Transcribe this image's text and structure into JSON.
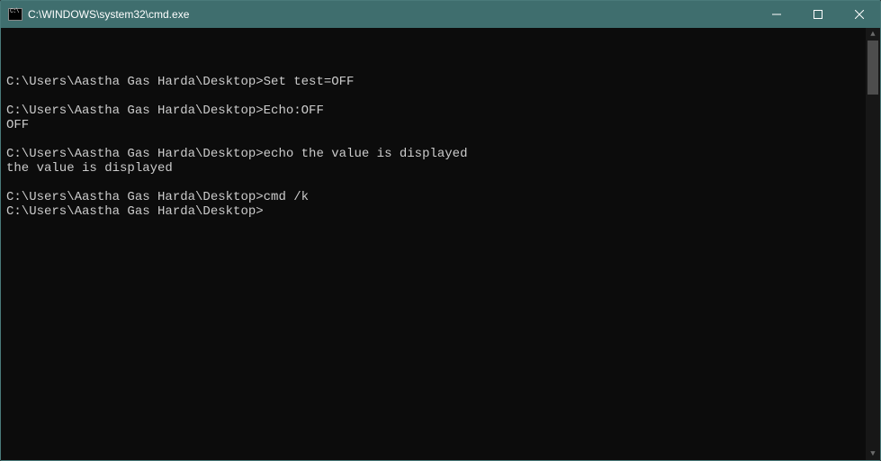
{
  "window": {
    "title": "C:\\WINDOWS\\system32\\cmd.exe"
  },
  "terminal": {
    "prompt": "C:\\Users\\Aastha Gas Harda\\Desktop>",
    "blocks": [
      {
        "command": "Set test=OFF",
        "output": []
      },
      {
        "command": "Echo:OFF",
        "output": [
          "OFF"
        ]
      },
      {
        "command": "echo the value is displayed",
        "output": [
          "the value is displayed"
        ]
      },
      {
        "command": "cmd /k",
        "output": []
      }
    ],
    "current_prompt": "C:\\Users\\Aastha Gas Harda\\Desktop>"
  }
}
